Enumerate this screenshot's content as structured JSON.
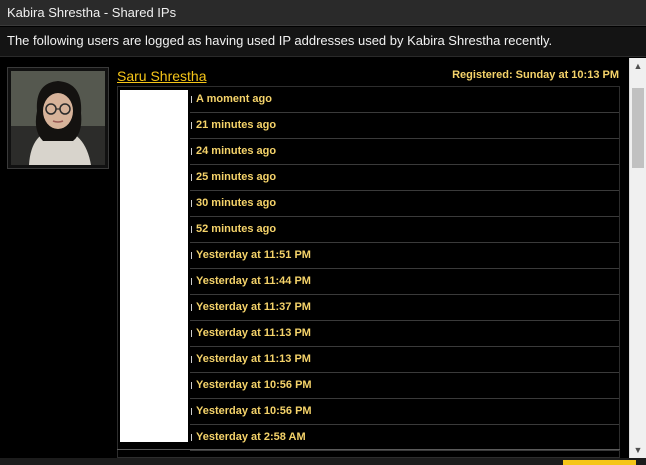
{
  "window": {
    "title": "Kabira Shrestha - Shared IPs"
  },
  "description": "The following users are logged as having used IP addresses used by Kabira Shrestha recently.",
  "user": {
    "name": "Saru Shrestha",
    "registered": "Registered: Sunday at 10:13 PM"
  },
  "ip_entries": [
    {
      "time": "A moment ago"
    },
    {
      "time": "21 minutes ago"
    },
    {
      "time": "24 minutes ago"
    },
    {
      "time": "25 minutes ago"
    },
    {
      "time": "30 minutes ago"
    },
    {
      "time": "52 minutes ago"
    },
    {
      "time": "Yesterday at 11:51 PM"
    },
    {
      "time": "Yesterday at 11:44 PM"
    },
    {
      "time": "Yesterday at 11:37 PM"
    },
    {
      "time": "Yesterday at 11:13 PM"
    },
    {
      "time": "Yesterday at 11:13 PM"
    },
    {
      "time": "Yesterday at 10:56 PM"
    },
    {
      "time": "Yesterday at 10:56 PM"
    },
    {
      "time": "Yesterday at 2:58 AM"
    }
  ],
  "colors": {
    "accent": "#f5c518",
    "time_text": "#f5d36a",
    "background": "#000000"
  },
  "icons": {
    "scroll_up": "scroll-up-arrow-icon",
    "scroll_down": "scroll-down-arrow-icon"
  }
}
